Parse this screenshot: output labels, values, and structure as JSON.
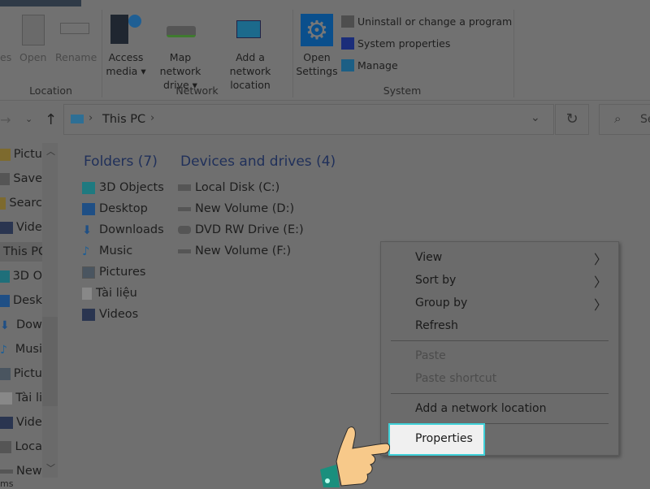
{
  "ribbon": {
    "location_group": {
      "label": "Location",
      "buttons": [
        "es",
        "Open",
        "Rename"
      ]
    },
    "network_group": {
      "label": "Network",
      "buttons": [
        {
          "line1": "Access",
          "line2": "media ▾"
        },
        {
          "line1": "Map network",
          "line2": "drive ▾"
        },
        {
          "line1": "Add a network",
          "line2": "location"
        }
      ]
    },
    "system_group": {
      "label": "System",
      "open_settings": {
        "line1": "Open",
        "line2": "Settings"
      },
      "items": [
        "Uninstall or change a program",
        "System properties",
        "Manage"
      ]
    }
  },
  "nav": {
    "breadcrumb": "This PC",
    "search_placeholder": "Se"
  },
  "sidebar": {
    "items": [
      "Pictu",
      "Save",
      "Searc",
      "Vide",
      "This PC",
      "3D O",
      "Desk",
      "Dow",
      "Musi",
      "Pictu",
      "Tài li",
      "Vide",
      "Loca",
      "New"
    ],
    "footer": "ms"
  },
  "main": {
    "folders_header": "Folders (7)",
    "folders": [
      "3D Objects",
      "Desktop",
      "Downloads",
      "Music",
      "Pictures",
      "Tài liệu",
      "Videos"
    ],
    "drives_header": "Devices and drives (4)",
    "drives": [
      "Local Disk (C:)",
      "New Volume (D:)",
      "DVD RW Drive (E:)",
      "New Volume (F:)"
    ]
  },
  "context_menu": {
    "items": [
      {
        "label": "View",
        "submenu": true
      },
      {
        "label": "Sort by",
        "submenu": true
      },
      {
        "label": "Group by",
        "submenu": true
      },
      {
        "label": "Refresh"
      },
      {
        "label": "Paste",
        "disabled": true
      },
      {
        "label": "Paste shortcut",
        "disabled": true
      },
      {
        "label": "Add a network location"
      },
      {
        "label": "Properties",
        "highlighted": true
      }
    ]
  },
  "colors": {
    "highlight_border": "#3fd0d8",
    "highlight_bg": "#f0f0f0",
    "hand_skin": "#f7c98a",
    "sleeve": "#1a8f7d",
    "settings_blue": "#0a4f8c"
  }
}
